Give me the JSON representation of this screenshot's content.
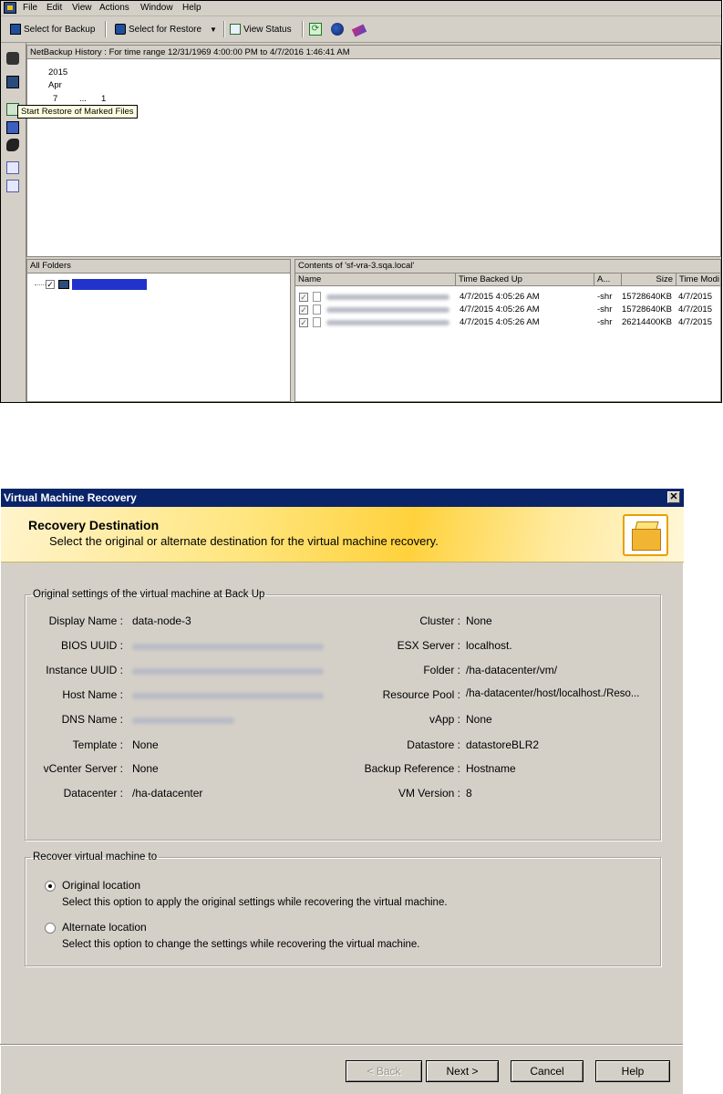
{
  "top_window": {
    "menu": [
      "File",
      "Edit",
      "View",
      "Actions",
      "Window",
      "Help"
    ],
    "toolbar": {
      "select_for_backup": "Select for Backup",
      "select_for_restore": "Select for Restore",
      "view_status": "View Status"
    },
    "history_header": "NetBackup History : For time range 12/31/1969 4:00:00 PM to 4/7/2016 1:46:41 AM",
    "history_tree": {
      "year": "2015",
      "month": "Apr",
      "day": "7",
      "ellipsis": "...",
      "count": "1"
    },
    "tooltip": "Start Restore of Marked Files",
    "folders": {
      "header": "All Folders"
    },
    "contents": {
      "header": "Contents of 'sf-vra-3.sqa.local'",
      "columns": [
        "Name",
        "Time Backed Up",
        "A...",
        "Size",
        "Time Modi"
      ],
      "rows": [
        {
          "time": "4/7/2015 4:05:26 AM",
          "attr": "-shr",
          "size": "15728640KB",
          "modified": "4/7/2015"
        },
        {
          "time": "4/7/2015 4:05:26 AM",
          "attr": "-shr",
          "size": "15728640KB",
          "modified": "4/7/2015"
        },
        {
          "time": "4/7/2015 4:05:26 AM",
          "attr": "-shr",
          "size": "26214400KB",
          "modified": "4/7/2015"
        }
      ]
    }
  },
  "dialog": {
    "title": "Virtual Machine Recovery",
    "close": "✕",
    "banner_title": "Recovery Destination",
    "banner_subtitle": "Select the original or alternate destination for the virtual machine recovery.",
    "original_settings": {
      "legend": "Original settings of the virtual machine at Back Up",
      "left": [
        {
          "label": "Display Name :",
          "value": "data-node-3"
        },
        {
          "label": "BIOS UUID :",
          "value": ""
        },
        {
          "label": "Instance UUID :",
          "value": ""
        },
        {
          "label": "Host Name :",
          "value": ""
        },
        {
          "label": "DNS Name :",
          "value": ""
        },
        {
          "label": "Template :",
          "value": "None"
        },
        {
          "label": "vCenter Server :",
          "value": "None"
        },
        {
          "label": "Datacenter :",
          "value": "/ha-datacenter"
        }
      ],
      "right": [
        {
          "label": "Cluster :",
          "value": "None"
        },
        {
          "label": "ESX Server :",
          "value": "localhost."
        },
        {
          "label": "Folder :",
          "value": "/ha-datacenter/vm/"
        },
        {
          "label": "Resource Pool :",
          "value": "/ha-datacenter/host/localhost./Reso..."
        },
        {
          "label": "vApp :",
          "value": "None"
        },
        {
          "label": "Datastore :",
          "value": "datastoreBLR2"
        },
        {
          "label": "Backup Reference :",
          "value": "Hostname"
        },
        {
          "label": "VM Version :",
          "value": "8"
        }
      ]
    },
    "recover_to": {
      "legend": "Recover virtual machine to",
      "options": [
        {
          "label": "Original location",
          "description": "Select this option to apply the original settings while recovering the virtual machine.",
          "selected": true
        },
        {
          "label": "Alternate location",
          "description": "Select this option to change the settings while recovering the virtual machine.",
          "selected": false
        }
      ]
    },
    "buttons": {
      "back": "< Back",
      "next": "Next >",
      "cancel": "Cancel",
      "help": "Help"
    }
  }
}
